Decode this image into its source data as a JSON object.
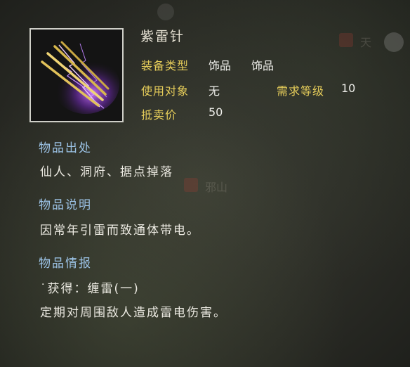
{
  "item": {
    "name": "紫雷针",
    "icon": "purple-lightning-needles-icon"
  },
  "stats": {
    "type_label": "装备类型",
    "type_value1": "饰品",
    "type_value2": "饰品",
    "target_label": "使用对象",
    "target_value": "无",
    "level_label": "需求等级",
    "level_value": "10",
    "price_label": "抵卖价",
    "price_value": "50"
  },
  "sections": {
    "source_title": "物品出处",
    "source_text": "仙人、洞府、据点掉落",
    "desc_title": "物品说明",
    "desc_text": "因常年引雷而致通体带电。",
    "info_title": "物品情报",
    "info_line1": "˙获得：缠雷(一)",
    "info_line2": "定期对周围敌人造成雷电伤害。"
  },
  "background": {
    "marker_top": "天",
    "marker_mid": "邪山"
  },
  "colors": {
    "label_gold": "#e6cd5a",
    "section_blue": "#9cc3e6",
    "text_white": "#eceae2"
  }
}
